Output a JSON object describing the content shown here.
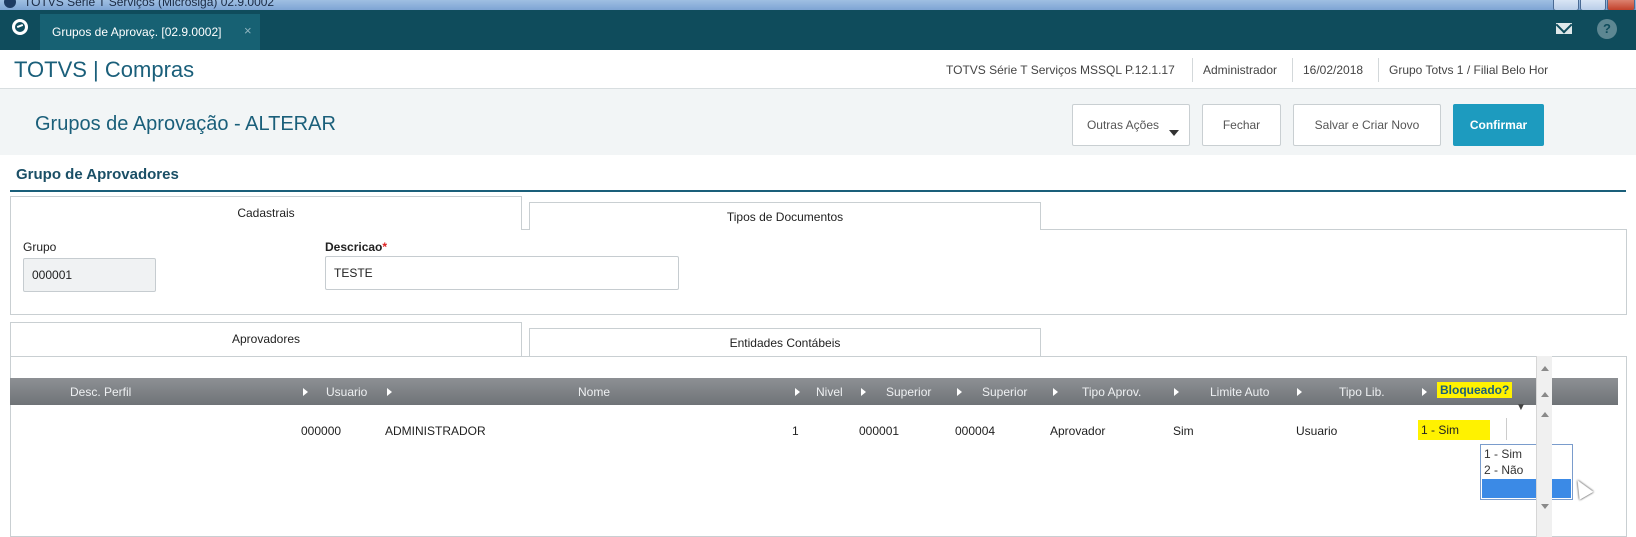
{
  "window": {
    "title": "TOTVS Série T Serviços (Microsiga) 02.9.0002"
  },
  "app_tab": {
    "label": "Grupos de Aprovaç. [02.9.0002]",
    "close": "×"
  },
  "topbar": {
    "mail_icon": "envelope-icon",
    "help_label": "?"
  },
  "header": {
    "brand": "TOTVS | Compras",
    "environment": "TOTVS Série T Serviços MSSQL P.12.1.17",
    "user": "Administrador",
    "date": "16/02/2018",
    "branch": "Grupo Totvs 1 / Filial Belo Hor"
  },
  "actions": {
    "page_title": "Grupos de Aprovação - ALTERAR",
    "more_label": "Outras Ações",
    "close_label": "Fechar",
    "save_new_label": "Salvar e Criar Novo",
    "confirm_label": "Confirmar"
  },
  "section": {
    "title": "Grupo de Aprovadores"
  },
  "upper_tabs": [
    "Cadastrais",
    "Tipos de Documentos"
  ],
  "form": {
    "grupo_label": "Grupo",
    "grupo_value": "000001",
    "descricao_label": "Descricao",
    "required_mark": "*",
    "descricao_value": "TESTE"
  },
  "lower_tabs": [
    "Aprovadores",
    "Entidades Contábeis"
  ],
  "grid": {
    "columns": [
      "Desc. Perfil",
      "Usuario",
      "Nome",
      "Nivel",
      "Superior",
      "Superior",
      "Tipo Aprov.",
      "Limite Auto",
      "Tipo Lib.",
      "Bloqueado?"
    ],
    "row": {
      "desc_perfil": "",
      "usuario": "000000",
      "nome": "ADMINISTRADOR",
      "nivel": "1",
      "superior1": "000001",
      "superior2": "000004",
      "tipo_aprov": "Aprovador",
      "limite_auto": "Sim",
      "tipo_lib": "Usuario",
      "bloqueado": "1 - Sim"
    },
    "dropdown_options": [
      "1 - Sim",
      "2 - Não",
      ""
    ]
  },
  "colors": {
    "teal_dark": "#0f4c5c",
    "accent": "#1a5f7a",
    "confirm": "#1d9bbf",
    "highlight": "#fff200"
  }
}
